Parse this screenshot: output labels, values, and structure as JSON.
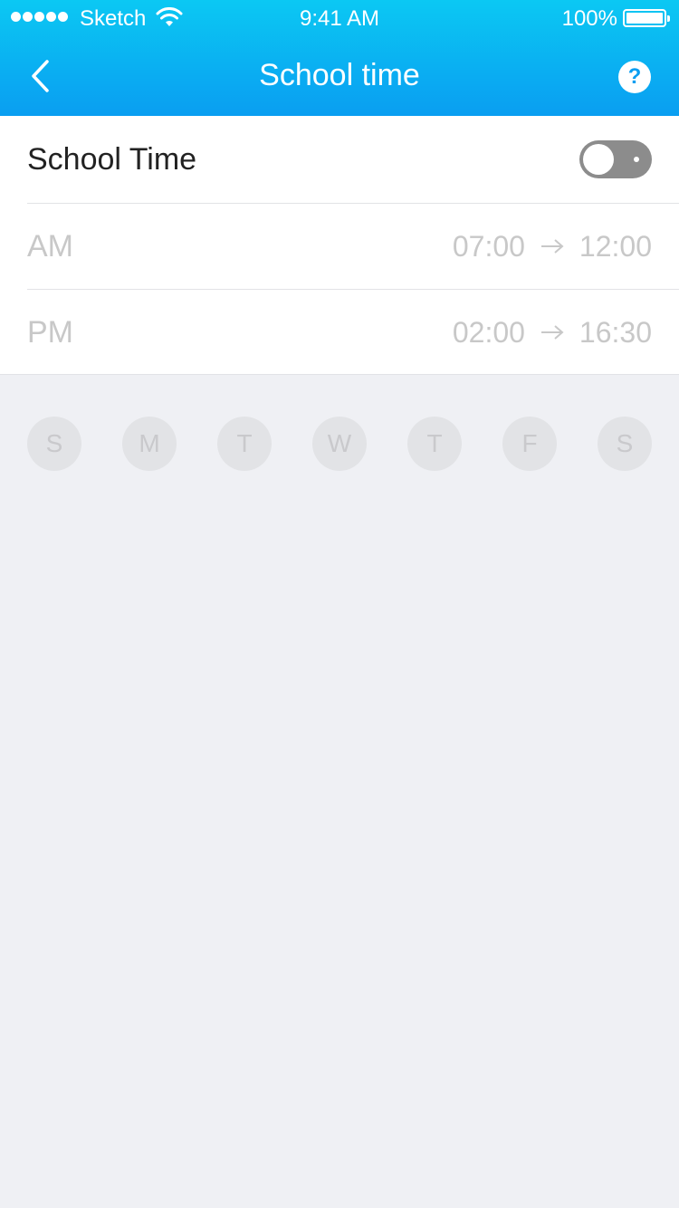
{
  "status_bar": {
    "carrier": "Sketch",
    "time": "9:41 AM",
    "battery": "100%"
  },
  "header": {
    "title": "School time",
    "help_label": "?"
  },
  "settings": {
    "toggle_label": "School Time",
    "toggle_on": false,
    "am": {
      "label": "AM",
      "start": "07:00",
      "end": "12:00"
    },
    "pm": {
      "label": "PM",
      "start": "02:00",
      "end": "16:30"
    }
  },
  "days": [
    "S",
    "M",
    "T",
    "W",
    "T",
    "F",
    "S"
  ],
  "colors": {
    "header_top": "#0bc8f3",
    "header_bottom": "#0a9ef1",
    "background": "#eff0f4",
    "toggle_off": "#8c8c8c",
    "muted_text": "#c8c8c8"
  }
}
